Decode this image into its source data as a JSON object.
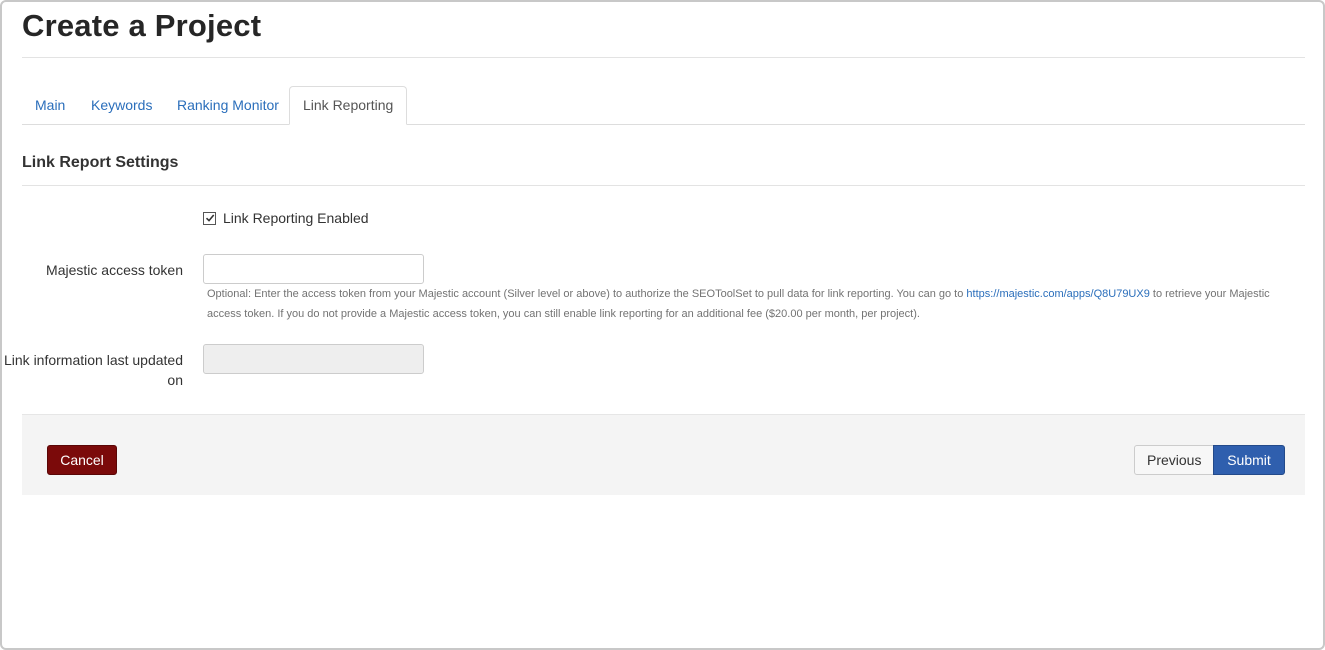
{
  "page": {
    "title": "Create a Project"
  },
  "tabs": [
    {
      "label": "Main",
      "active": false
    },
    {
      "label": "Keywords",
      "active": false
    },
    {
      "label": "Ranking Monitor",
      "active": false
    },
    {
      "label": "Link Reporting",
      "active": true
    }
  ],
  "section": {
    "title": "Link Report Settings"
  },
  "link_reporting": {
    "enabled_label": "Link Reporting Enabled",
    "enabled": true
  },
  "token_field": {
    "label": "Majestic access token",
    "value": "",
    "placeholder": ""
  },
  "help": {
    "before_link": "Optional: Enter the access token from your Majestic account (Silver level or above) to authorize the SEOToolSet to pull data for link reporting. You can go to ",
    "link_text": "https://majestic.com/apps/Q8U79UX9",
    "after_link": " to retrieve your Majestic access token. If you do not provide a Majestic access token, you can still enable link reporting for an additional fee ($20.00 per month, per project)."
  },
  "updated_field": {
    "label": "Link information last updated on",
    "value": ""
  },
  "footer": {
    "cancel_label": "Cancel",
    "previous_label": "Previous",
    "submit_label": "Submit"
  },
  "colors": {
    "link": "#2a6ebb",
    "cancel": "#7b0a0a",
    "submit": "#2f5fae",
    "footer_bg": "#f4f4f4"
  }
}
